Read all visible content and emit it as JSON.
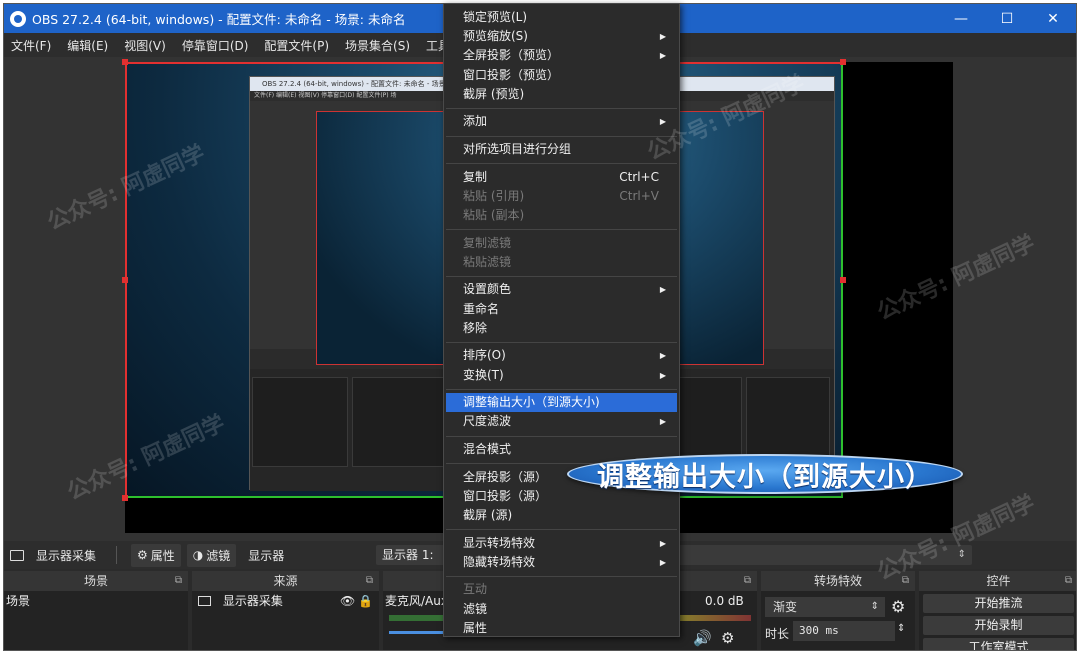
{
  "window": {
    "title": "OBS 27.2.4 (64-bit, windows) - 配置文件: 未命名 - 场景: 未命名",
    "minimize": "—",
    "maximize": "☐",
    "close": "✕"
  },
  "menubar": [
    "文件(F)",
    "编辑(E)",
    "视图(V)",
    "停靠窗口(D)",
    "配置文件(P)",
    "场景集合(S)",
    "工具("
  ],
  "nested_preview": {
    "title": "OBS 27.2.4 (64-bit, windows) - 配置文件: 未命名 - 场景: 未命名",
    "menu": "文件(F)   编辑(E)   视图(V)   停靠窗口(D)   配置文件(P)   场"
  },
  "context_menu": [
    {
      "label": "锁定预览(L)",
      "enabled": true
    },
    {
      "label": "预览缩放(S)",
      "enabled": true,
      "submenu": true
    },
    {
      "label": "全屏投影（预览）",
      "enabled": true,
      "submenu": true
    },
    {
      "label": "窗口投影（预览）",
      "enabled": true
    },
    {
      "label": "截屏 (预览)",
      "enabled": true
    },
    {
      "separator": true
    },
    {
      "label": "添加",
      "enabled": true,
      "submenu": true
    },
    {
      "separator": true
    },
    {
      "label": "对所选项目进行分组",
      "enabled": true
    },
    {
      "separator": true
    },
    {
      "label": "复制",
      "enabled": true,
      "shortcut": "Ctrl+C"
    },
    {
      "label": "粘贴 (引用)",
      "enabled": false,
      "shortcut": "Ctrl+V"
    },
    {
      "label": "粘贴 (副本)",
      "enabled": false
    },
    {
      "separator": true
    },
    {
      "label": "复制滤镜",
      "enabled": false
    },
    {
      "label": "粘贴滤镜",
      "enabled": false
    },
    {
      "separator": true
    },
    {
      "label": "设置颜色",
      "enabled": true,
      "submenu": true
    },
    {
      "label": "重命名",
      "enabled": true
    },
    {
      "label": "移除",
      "enabled": true
    },
    {
      "separator": true
    },
    {
      "label": "排序(O)",
      "enabled": true,
      "submenu": true
    },
    {
      "label": "变换(T)",
      "enabled": true,
      "submenu": true
    },
    {
      "separator": true
    },
    {
      "label": "调整输出大小（到源大小)",
      "enabled": true,
      "highlighted": true
    },
    {
      "label": "尺度滤波",
      "enabled": true,
      "submenu": true
    },
    {
      "separator": true
    },
    {
      "label": "混合模式",
      "enabled": true
    },
    {
      "separator": true
    },
    {
      "label": "全屏投影（源）",
      "enabled": true
    },
    {
      "label": "窗口投影（源）",
      "enabled": true
    },
    {
      "label": "截屏 (源)",
      "enabled": true
    },
    {
      "separator": true
    },
    {
      "label": "显示转场特效",
      "enabled": true,
      "submenu": true
    },
    {
      "label": "隐藏转场特效",
      "enabled": true,
      "submenu": true
    },
    {
      "separator": true
    },
    {
      "label": "互动",
      "enabled": false
    },
    {
      "label": "滤镜",
      "enabled": true
    },
    {
      "label": "属性",
      "enabled": true
    }
  ],
  "callout": {
    "text": "调整输出大小（到源大小）"
  },
  "source_bar": {
    "source_name": "显示器采集",
    "properties": "属性",
    "filters": "滤镜",
    "display_label": "显示器",
    "display_value": "显示器 1:"
  },
  "docks": {
    "scenes": {
      "header": "场景",
      "items": [
        "场景"
      ]
    },
    "sources": {
      "header": "来源",
      "items": [
        "显示器采集"
      ]
    },
    "mixer": {
      "header": "",
      "track": "麦克风/Aux",
      "db": "0.0 dB"
    },
    "transitions": {
      "header": "转场特效",
      "type": "渐变",
      "duration_label": "时长",
      "duration_value": "300 ms"
    },
    "controls": {
      "header": "控件",
      "buttons": [
        "开始推流",
        "开始录制",
        "工作室模式"
      ]
    }
  },
  "watermarks": [
    "公众号: 阿虚同学"
  ],
  "colors": {
    "titlebar": "#1e63c8",
    "highlight": "#2b6cd8",
    "selection_red": "#e23030",
    "selection_green": "#2ec02e"
  }
}
